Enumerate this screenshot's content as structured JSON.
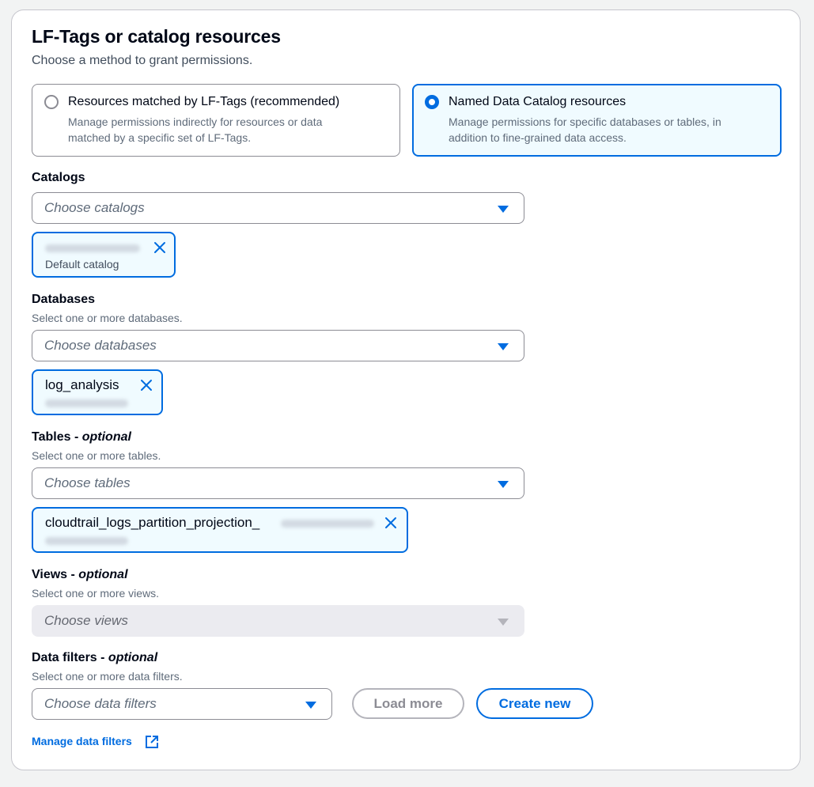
{
  "section": {
    "title": "LF-Tags or catalog resources",
    "subtitle": "Choose a method to grant permissions."
  },
  "methods": [
    {
      "label": "Resources matched by LF-Tags (recommended)",
      "description_line1": "Manage permissions indirectly for resources or data",
      "description_line2": "matched by a specific set of LF-Tags.",
      "selected": false
    },
    {
      "label": "Named Data Catalog resources",
      "description_line1": "Manage permissions for specific databases or tables, in",
      "description_line2": "addition to fine-grained data access.",
      "selected": true
    }
  ],
  "catalogs": {
    "label": "Catalogs",
    "placeholder": "Choose catalogs",
    "token_description": "Default catalog"
  },
  "databases": {
    "label": "Databases",
    "description": "Select one or more databases.",
    "placeholder": "Choose databases",
    "token_label": "log_analysis"
  },
  "tables": {
    "label": "Tables - ",
    "optional": "optional",
    "description": "Select one or more tables.",
    "placeholder": "Choose tables",
    "token_label": "cloudtrail_logs_partition_projection_"
  },
  "views": {
    "label": "Views - ",
    "optional": "optional",
    "description": "Select one or more views.",
    "placeholder": "Choose views",
    "disabled": true
  },
  "data_filters": {
    "label": "Data filters - ",
    "optional": "optional",
    "description": "Select one or more data filters.",
    "placeholder": "Choose data filters",
    "load_more_label": "Load more",
    "create_new_label": "Create new",
    "manage_link": "Manage data filters"
  },
  "colors": {
    "accent": "#006ce0",
    "selected_bg": "#f0fbff",
    "border": "#8c8c94"
  },
  "icons": [
    "dropdown-caret-icon",
    "dismiss-x-icon",
    "external-link-icon",
    "radio-icon"
  ]
}
